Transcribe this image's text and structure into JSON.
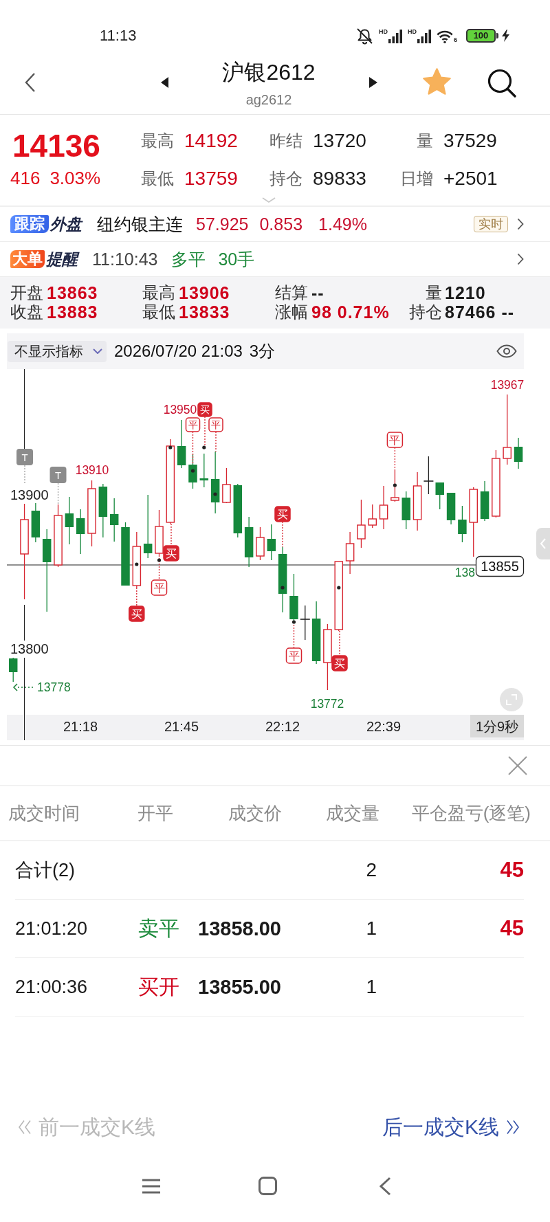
{
  "status_bar": {
    "time": "11:13",
    "networks": [
      {
        "label": "HD"
      },
      {
        "label": "HD"
      }
    ],
    "wifi_label": "6",
    "battery": "100",
    "charging": true
  },
  "header": {
    "title": "沪银2612",
    "subtitle": "ag2612",
    "favorite": true
  },
  "quote": {
    "price": "14136",
    "change": "416",
    "change_percent": "3.03%",
    "stats": [
      {
        "label": "最高",
        "value": "14192",
        "color": "#d0021b"
      },
      {
        "label": "昨结",
        "value": "13720",
        "color": "#1a1a1a"
      },
      {
        "label": "量",
        "value": "37529",
        "color": "#1a1a1a"
      },
      {
        "label": "最低",
        "value": "13759",
        "color": "#d0021b"
      },
      {
        "label": "持仓",
        "value": "89833",
        "color": "#1a1a1a"
      },
      {
        "label": "日增",
        "value": "+2501",
        "color": "#1a1a1a"
      }
    ]
  },
  "tracking": {
    "badge": "跟踪",
    "badge_caption": "外盘",
    "name": "纽约银主连",
    "values": [
      "57.925",
      "0.853",
      "1.49%"
    ],
    "tag": "实时"
  },
  "alert": {
    "badge": "大单",
    "badge_caption": "提醒",
    "time": "11:10:43",
    "action": "多平",
    "volume": "30手"
  },
  "bar_info": [
    {
      "label": "开盘",
      "reading": "13863",
      "color": "#d0021b"
    },
    {
      "label": "最高",
      "reading": "13906",
      "color": "#d0021b"
    },
    {
      "label": "结算",
      "reading": "--",
      "color": "#1a1a1a"
    },
    {
      "label": "量",
      "reading": "1210",
      "color": "#1a1a1a"
    },
    {
      "label": "收盘",
      "reading": "13883",
      "color": "#d0021b"
    },
    {
      "label": "最低",
      "reading": "13833",
      "color": "#d0021b"
    },
    {
      "label": "涨幅",
      "reading": "98 0.71%",
      "color": "#d0021b"
    },
    {
      "label": "持仓",
      "reading": "87466 --",
      "color": "#1a1a1a"
    }
  ],
  "chart": {
    "indicator": "不显示指标",
    "datetime": "2026/07/20 21:03",
    "period": "3分",
    "price_labels": [
      {
        "text": "13967",
        "color": "#c8102e"
      },
      {
        "text": "13950",
        "color": "#c8102e"
      },
      {
        "text": "13910",
        "color": "#c8102e"
      },
      {
        "text": "138",
        "color": "#1a7f37"
      },
      {
        "text": "13778",
        "color": "#1a7f37"
      },
      {
        "text": "13772",
        "color": "#1a7f37"
      }
    ],
    "flags": [
      "T",
      "T"
    ],
    "y_axis_labels": [
      "13900",
      "13800"
    ],
    "markers": [
      {
        "label": "买",
        "kind": "filled"
      },
      {
        "label": "平",
        "kind": "outlined"
      },
      {
        "label": "买",
        "kind": "filled"
      },
      {
        "label": "平",
        "kind": "outlined"
      },
      {
        "label": "买",
        "kind": "filled"
      },
      {
        "label": "平",
        "kind": "outlined"
      },
      {
        "label": "买",
        "kind": "filled"
      },
      {
        "label": "平",
        "kind": "outlined"
      },
      {
        "label": "买",
        "kind": "filled"
      },
      {
        "label": "平",
        "kind": "outlined"
      }
    ],
    "current_price": "13855",
    "x_axis_labels": [
      "21:18",
      "21:45",
      "22:12",
      "22:39"
    ],
    "countdown": "1分9秒"
  },
  "trades": {
    "columns": [
      "成交时间",
      "开平",
      "成交价",
      "成交量",
      "平仓盈亏(逐笔)"
    ],
    "total": {
      "label": "合计(2)",
      "volume": "2",
      "pnl": "45"
    },
    "rows": [
      {
        "time": "21:01:20",
        "side": "卖平",
        "color": "#1a8a3a",
        "price": "13858.00",
        "volume": "1",
        "pnl": "45"
      },
      {
        "time": "21:00:36",
        "side": "买开",
        "color": "#d0021b",
        "price": "13855.00",
        "volume": "1"
      }
    ]
  },
  "navigation": {
    "previous": {
      "label": "前一成交K线",
      "disabled": true
    },
    "next": {
      "label": "后一成交K线",
      "disabled": false
    }
  }
}
